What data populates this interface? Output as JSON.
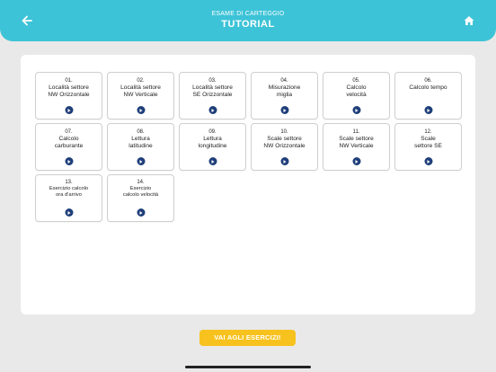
{
  "header": {
    "subtitle": "ESAME DI CARTEGGIO",
    "title": "TUTORIAL",
    "back_icon": "arrow-left-icon",
    "home_icon": "home-icon",
    "color": "#3dc3d7"
  },
  "cards": [
    {
      "num": "01.",
      "label": "Località settore\nNW Orizzontale"
    },
    {
      "num": "02.",
      "label": "Località settore\nNW Verticale"
    },
    {
      "num": "03.",
      "label": "Località settore\nSE Orizzontale"
    },
    {
      "num": "04.",
      "label": "Misurazione\nmiglia"
    },
    {
      "num": "05.",
      "label": "Calcolo\nvelocità"
    },
    {
      "num": "06.",
      "label": "Calcolo tempo"
    },
    {
      "num": "07.",
      "label": "Calcolo\ncarburante"
    },
    {
      "num": "08.",
      "label": "Lettura\nlatitudine"
    },
    {
      "num": "09.",
      "label": "Lettura\nlongitudine"
    },
    {
      "num": "10.",
      "label": "Scale settore\nNW Orizzontale"
    },
    {
      "num": "11.",
      "label": "Scale settore\nNW Verticale"
    },
    {
      "num": "12.",
      "label": "Scale\nsettore SE"
    },
    {
      "num": "13.",
      "label": "Esercizio calcolo\nora d'arrivo"
    },
    {
      "num": "14.",
      "label": "Esercizio\ncalcolo velocità"
    }
  ],
  "play_icon": "play-icon",
  "cta": {
    "label": "VAI AGLI ESERCIZI!",
    "color": "#f7c21e"
  }
}
